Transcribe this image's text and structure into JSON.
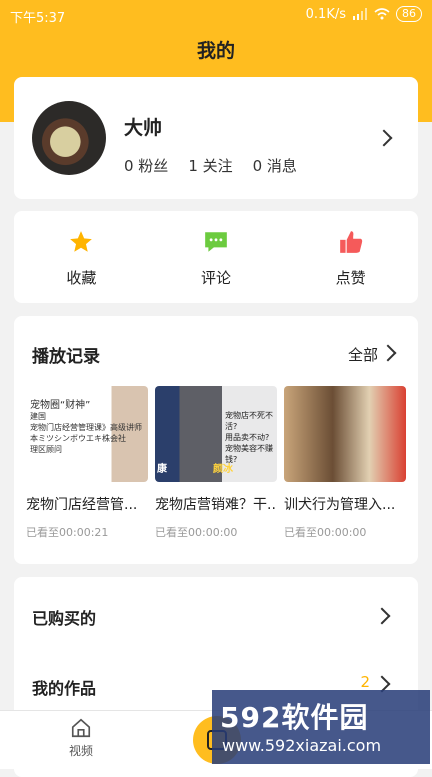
{
  "status": {
    "time": "下午5:37",
    "speed": "0.1K/s",
    "battery": "86"
  },
  "header": {
    "title": "我的"
  },
  "profile": {
    "name": "大帅",
    "fans": "0 粉丝",
    "follows": "1 关注",
    "messages": "0 消息"
  },
  "actions": [
    {
      "label": "收藏",
      "icon": "star-icon",
      "color": "#ffb400"
    },
    {
      "label": "评论",
      "icon": "comment-icon",
      "color": "#6ccb3f"
    },
    {
      "label": "点赞",
      "icon": "thumbs-up-icon",
      "color": "#f55a5a"
    }
  ],
  "history": {
    "title": "播放记录",
    "all_label": "全部",
    "items": [
      {
        "title": "宠物门店经营管...",
        "watched": "已看至00:00:21",
        "lines": [
          "宠物圈“财神”",
          "建国",
          "宠物门店经营管理课》高级讲师",
          "本ミツシンボウエキ株会社",
          "理区顾问"
        ]
      },
      {
        "title": "宠物店营销难？干...",
        "watched": "已看至00:00:00",
        "lines": [
          "宠物店不死不活?",
          "用品卖不动?",
          "宠物美容不赚钱?",
          "康",
          "颜冰"
        ]
      },
      {
        "title": "训犬行为管理入...",
        "watched": "已看至00:00:00",
        "lines": []
      }
    ]
  },
  "purchased": {
    "label": "已购买的"
  },
  "works": {
    "label": "我的作品",
    "count": "2"
  },
  "tabs": {
    "video": "视频"
  },
  "watermark": {
    "brand": "592软件园",
    "url": "www.592xiazai.com"
  }
}
